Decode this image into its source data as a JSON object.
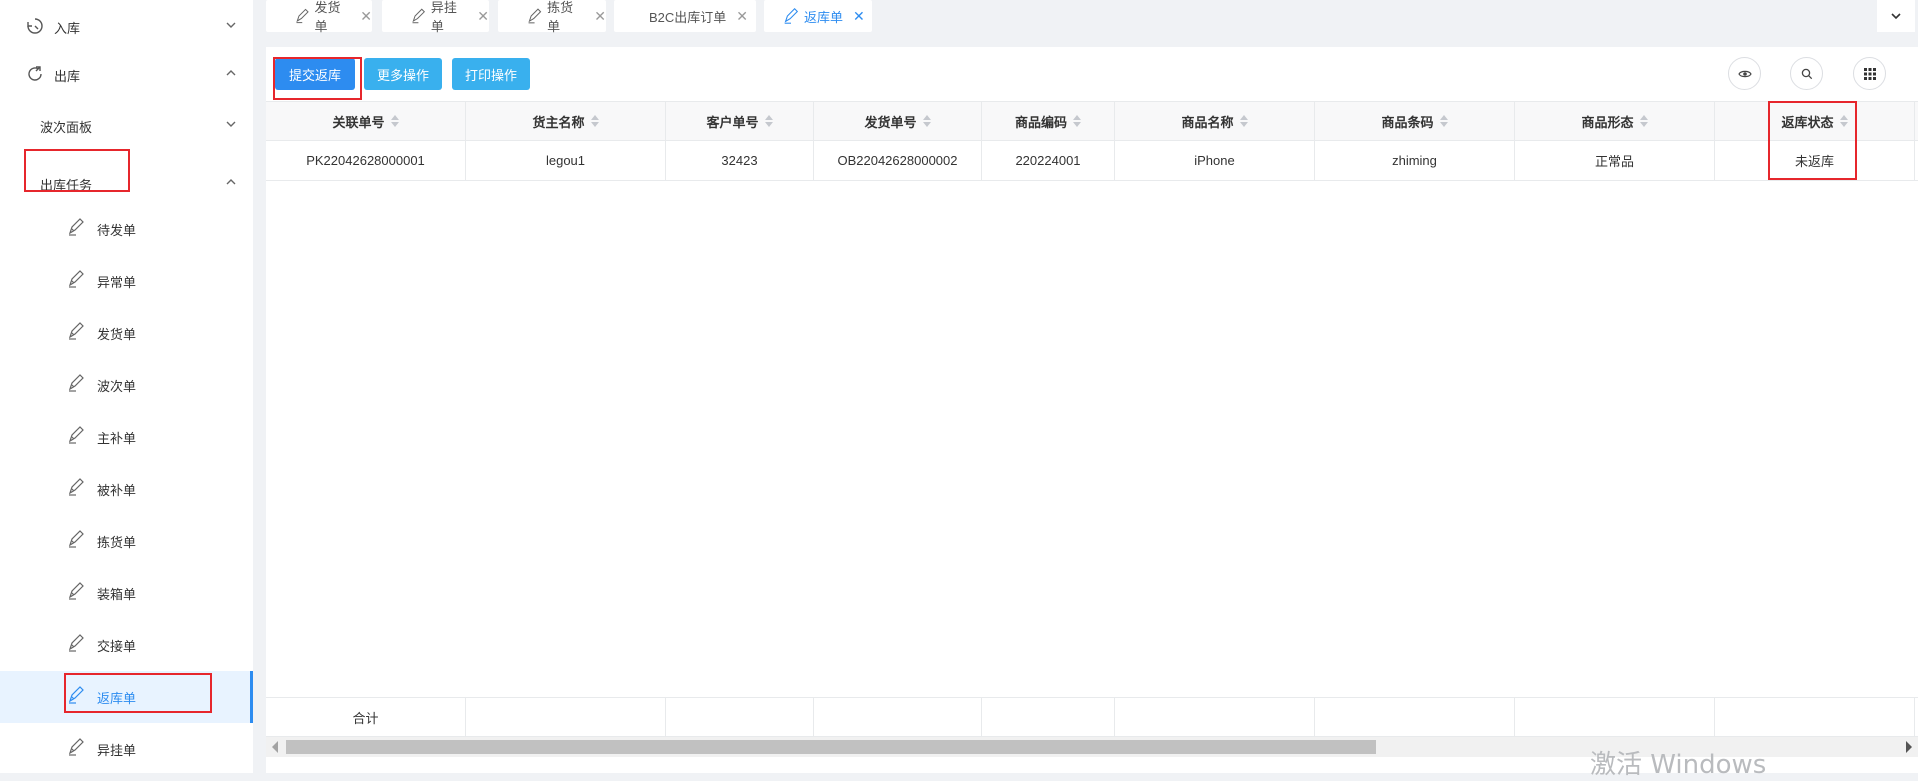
{
  "sidebar": {
    "inbound": "入库",
    "outbound": "出库",
    "wave_panel": "波次面板",
    "outbound_task": "出库任务",
    "items": [
      "待发单",
      "异常单",
      "发货单",
      "波次单",
      "主补单",
      "被补单",
      "拣货单",
      "装箱单",
      "交接单",
      "返库单",
      "异挂单"
    ]
  },
  "tabs": [
    {
      "label": "发货单"
    },
    {
      "label": "异挂单"
    },
    {
      "label": "拣货单"
    },
    {
      "label": "B2C出库订单"
    },
    {
      "label": "返库单"
    }
  ],
  "toolbar": {
    "submit_label": "提交返库",
    "more_label": "更多操作",
    "print_label": "打印操作"
  },
  "table": {
    "columns": [
      "关联单号",
      "货主名称",
      "客户单号",
      "发货单号",
      "商品编码",
      "商品名称",
      "商品条码",
      "商品形态",
      "返库状态"
    ],
    "rows": [
      [
        "PK22042628000001",
        "legou1",
        "32423",
        "OB22042628000002",
        "220224001",
        "iPhone",
        "zhiming",
        "正常品",
        "未返库"
      ]
    ],
    "footer_label": "合计"
  },
  "watermark": "激活 Windows",
  "colors": {
    "primary": "#2d8cf0",
    "secondary": "#39b0ee",
    "highlight": "#e6262c"
  }
}
